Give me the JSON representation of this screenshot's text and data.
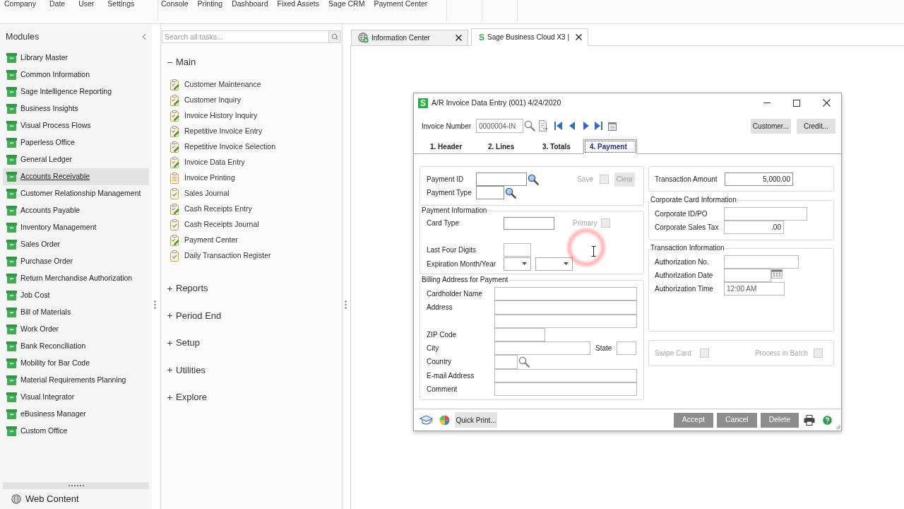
{
  "menu_bar": {
    "groups": [
      {
        "items": [
          "Company",
          "Date",
          "User",
          "Settings"
        ]
      },
      {
        "items": [
          "Console",
          "Printing",
          "Dashboard",
          "Fixed Assets",
          "Sage CRM",
          "Payment Center"
        ]
      }
    ]
  },
  "modules": {
    "title": "Modules",
    "items": [
      {
        "label": "Library Master",
        "selected": false
      },
      {
        "label": "Common Information",
        "selected": false
      },
      {
        "label": "Sage Intelligence Reporting",
        "selected": false
      },
      {
        "label": "Business Insights",
        "selected": false
      },
      {
        "label": "Visual Process Flows",
        "selected": false
      },
      {
        "label": "Paperless Office",
        "selected": false
      },
      {
        "label": "General Ledger",
        "selected": false
      },
      {
        "label": "Accounts Receivable",
        "selected": true
      },
      {
        "label": "Customer Relationship Management",
        "selected": false
      },
      {
        "label": "Accounts Payable",
        "selected": false
      },
      {
        "label": "Inventory Management",
        "selected": false
      },
      {
        "label": "Sales Order",
        "selected": false
      },
      {
        "label": "Purchase Order",
        "selected": false
      },
      {
        "label": "Return Merchandise Authorization",
        "selected": false
      },
      {
        "label": "Job Cost",
        "selected": false
      },
      {
        "label": "Bill of Materials",
        "selected": false
      },
      {
        "label": "Work Order",
        "selected": false
      },
      {
        "label": "Bank Reconciliation",
        "selected": false
      },
      {
        "label": "Mobility for Bar Code",
        "selected": false
      },
      {
        "label": "Material Requirements Planning",
        "selected": false
      },
      {
        "label": "Visual Integrator",
        "selected": false
      },
      {
        "label": "eBusiness Manager",
        "selected": false
      },
      {
        "label": "Custom Office",
        "selected": false
      }
    ],
    "footer": "Web Content"
  },
  "tasks": {
    "search": {
      "placeholder": "Search all tasks..."
    },
    "groups": [
      {
        "label": "Main",
        "expanded": true,
        "items": [
          {
            "label": "Customer Maintenance",
            "kind": "entry"
          },
          {
            "label": "Customer Inquiry",
            "kind": "entry"
          },
          {
            "label": "Invoice History Inquiry",
            "kind": "entry"
          },
          {
            "label": "Repetitive Invoice Entry",
            "kind": "entry"
          },
          {
            "label": "Repetitive Invoice Selection",
            "kind": "entry"
          },
          {
            "label": "Invoice Data Entry",
            "kind": "entry"
          },
          {
            "label": "Invoice Printing",
            "kind": "print"
          },
          {
            "label": "Sales Journal",
            "kind": "report"
          },
          {
            "label": "Cash Receipts Entry",
            "kind": "entry"
          },
          {
            "label": "Cash Receipts Journal",
            "kind": "report"
          },
          {
            "label": "Payment Center",
            "kind": "entry"
          },
          {
            "label": "Daily Transaction Register",
            "kind": "report"
          }
        ]
      },
      {
        "label": "Reports",
        "expanded": false
      },
      {
        "label": "Period End",
        "expanded": false
      },
      {
        "label": "Setup",
        "expanded": false
      },
      {
        "label": "Utilities",
        "expanded": false
      },
      {
        "label": "Explore",
        "expanded": false
      }
    ]
  },
  "workspace_tabs": [
    {
      "label": "Information Center",
      "kind": "globe",
      "selected": false
    },
    {
      "label": "Sage Business Cloud X3 |",
      "kind": "logo",
      "logo": "S",
      "selected": true
    }
  ],
  "dialog": {
    "logo": "S",
    "title": "A/R Invoice Data Entry (001) 4/24/2020",
    "invoice_number": {
      "label": "Invoice Number",
      "value": "0000004-IN"
    },
    "header_buttons": [
      "Customer...",
      "Credit..."
    ],
    "tabs": [
      {
        "label": "1. Header",
        "selected": false
      },
      {
        "label": "2. Lines",
        "selected": false
      },
      {
        "label": "3. Totals",
        "selected": false
      },
      {
        "label": "4. Payment",
        "selected": true
      }
    ],
    "payment_lookup": {
      "fields": [
        {
          "label": "Payment ID"
        },
        {
          "label": "Payment Type"
        }
      ],
      "save": {
        "label": "Save",
        "checked": false,
        "disabled": true
      },
      "clear_button": {
        "label": "Clear",
        "disabled": true
      }
    },
    "payment_information": {
      "title": "Payment Information",
      "card_type": {
        "label": "Card Type"
      },
      "primary": {
        "label": "Primary",
        "checked": false,
        "disabled": true
      },
      "last_four_digits": {
        "label": "Last Four Digits"
      },
      "expiration": {
        "label": "Expiration Month/Year"
      }
    },
    "billing_address": {
      "title": "Billing Address for Payment",
      "fields": [
        {
          "label": "Cardholder Name",
          "kind": "wide"
        },
        {
          "label": "Address",
          "kind": "address"
        },
        {
          "label": "ZIP Code",
          "kind": "zip"
        },
        {
          "label": "City",
          "kind": "city",
          "extra_label": "State"
        },
        {
          "label": "Country",
          "kind": "lookup"
        },
        {
          "label": "E-mail Address",
          "kind": "wide"
        },
        {
          "label": "Comment",
          "kind": "wide"
        }
      ]
    },
    "transaction_amount": {
      "label": "Transaction Amount",
      "value": "5,000.00"
    },
    "corporate_card": {
      "title": "Corporate Card Information",
      "fields": [
        {
          "label": "Corporate ID/PO",
          "kind": "text"
        },
        {
          "label": "Corporate Sales Tax",
          "kind": "amount",
          "value": ".00"
        }
      ]
    },
    "transaction_information": {
      "title": "Transaction Information",
      "fields": [
        {
          "label": "Authorization No.",
          "kind": "text"
        },
        {
          "label": "Authorization Date",
          "kind": "date"
        },
        {
          "label": "Authorization Time",
          "kind": "time",
          "value": "12:00 AM"
        }
      ]
    },
    "options": [
      {
        "label": "Swipe Card",
        "checked": false,
        "disabled": true
      },
      {
        "label": "Process in Batch",
        "checked": false,
        "disabled": true
      }
    ],
    "footer": {
      "quick_print": "Quick Print...",
      "buttons": [
        "Accept",
        "Cancel",
        "Delete"
      ]
    }
  }
}
